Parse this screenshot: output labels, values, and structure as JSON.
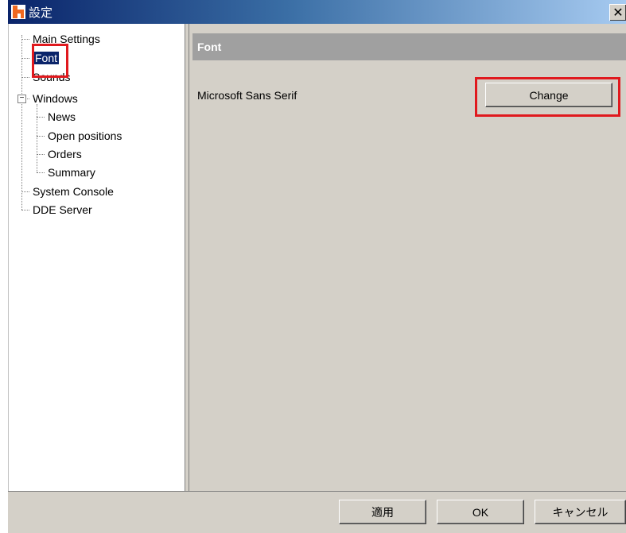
{
  "window": {
    "title": "設定",
    "close_glyph": "✕"
  },
  "tree": {
    "items": [
      {
        "label": "Main Settings"
      },
      {
        "label": "Font"
      },
      {
        "label": "Sounds"
      },
      {
        "label": "Windows",
        "expander": "−"
      },
      {
        "label": "News"
      },
      {
        "label": "Open positions"
      },
      {
        "label": "Orders"
      },
      {
        "label": "Summary"
      },
      {
        "label": "System Console"
      },
      {
        "label": "DDE Server"
      }
    ]
  },
  "panel": {
    "header": "Font",
    "font_name": "Microsoft Sans Serif",
    "change_label": "Change"
  },
  "footer": {
    "apply_label": "適用",
    "ok_label": "OK",
    "cancel_label": "キャンセル"
  },
  "colors": {
    "highlight": "#e0191e",
    "selection": "#0a246a",
    "app_icon": "#f06820"
  },
  "icons": {
    "app": "app-logo-icon",
    "close": "close-icon",
    "expander": "collapse-minus-icon"
  }
}
